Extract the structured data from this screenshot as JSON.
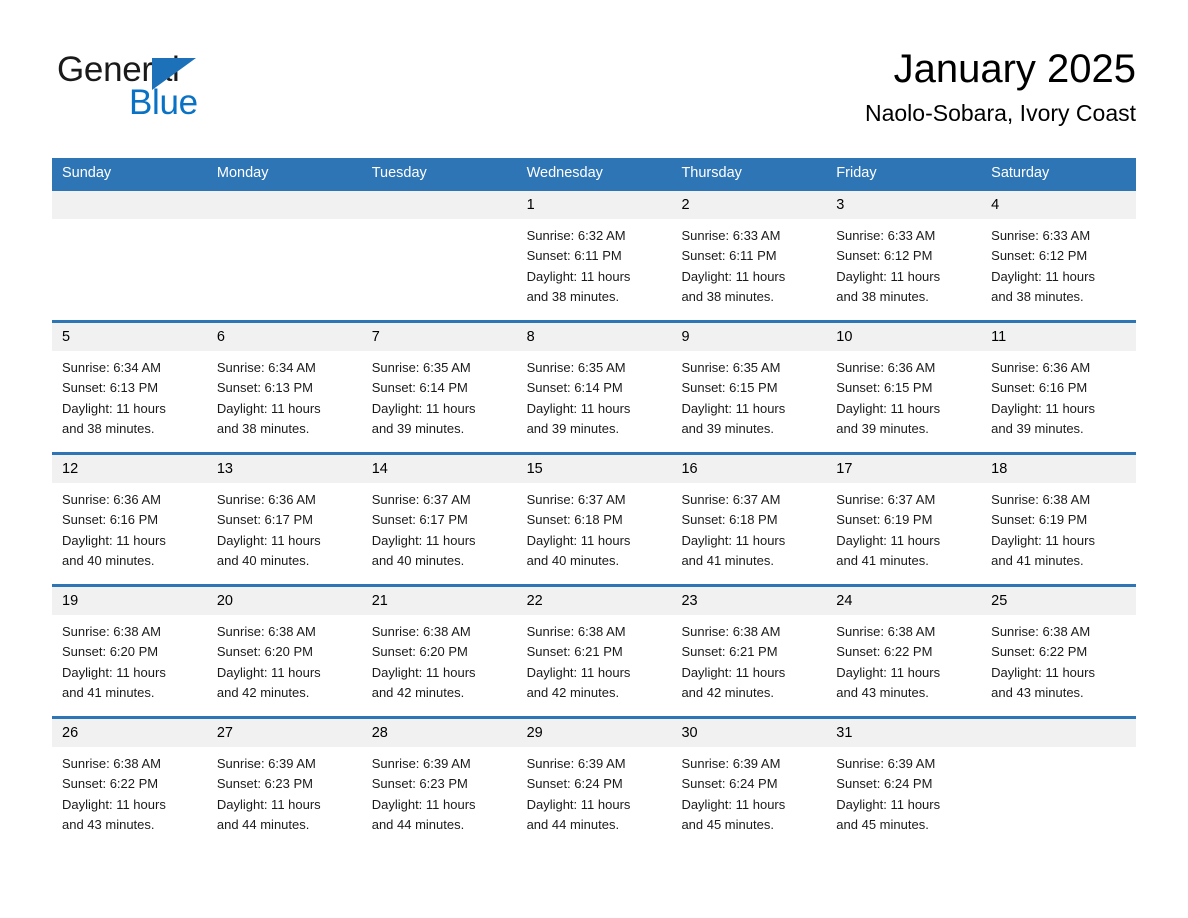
{
  "brand": {
    "word1": "General",
    "word2": "Blue",
    "accent_color": "#0a72c4",
    "triangle_color": "#1d71b8"
  },
  "header": {
    "month_title": "January 2025",
    "location": "Naolo-Sobara, Ivory Coast"
  },
  "calendar": {
    "header_color": "#2e75b6",
    "row_border_color": "#2e75b6",
    "day_band_color": "#f1f1f1",
    "weekdays": [
      "Sunday",
      "Monday",
      "Tuesday",
      "Wednesday",
      "Thursday",
      "Friday",
      "Saturday"
    ],
    "weeks": [
      [
        {
          "day": "",
          "sunrise": "",
          "sunset": "",
          "daylight1": "",
          "daylight2": ""
        },
        {
          "day": "",
          "sunrise": "",
          "sunset": "",
          "daylight1": "",
          "daylight2": ""
        },
        {
          "day": "",
          "sunrise": "",
          "sunset": "",
          "daylight1": "",
          "daylight2": ""
        },
        {
          "day": "1",
          "sunrise": "Sunrise: 6:32 AM",
          "sunset": "Sunset: 6:11 PM",
          "daylight1": "Daylight: 11 hours",
          "daylight2": "and 38 minutes."
        },
        {
          "day": "2",
          "sunrise": "Sunrise: 6:33 AM",
          "sunset": "Sunset: 6:11 PM",
          "daylight1": "Daylight: 11 hours",
          "daylight2": "and 38 minutes."
        },
        {
          "day": "3",
          "sunrise": "Sunrise: 6:33 AM",
          "sunset": "Sunset: 6:12 PM",
          "daylight1": "Daylight: 11 hours",
          "daylight2": "and 38 minutes."
        },
        {
          "day": "4",
          "sunrise": "Sunrise: 6:33 AM",
          "sunset": "Sunset: 6:12 PM",
          "daylight1": "Daylight: 11 hours",
          "daylight2": "and 38 minutes."
        }
      ],
      [
        {
          "day": "5",
          "sunrise": "Sunrise: 6:34 AM",
          "sunset": "Sunset: 6:13 PM",
          "daylight1": "Daylight: 11 hours",
          "daylight2": "and 38 minutes."
        },
        {
          "day": "6",
          "sunrise": "Sunrise: 6:34 AM",
          "sunset": "Sunset: 6:13 PM",
          "daylight1": "Daylight: 11 hours",
          "daylight2": "and 38 minutes."
        },
        {
          "day": "7",
          "sunrise": "Sunrise: 6:35 AM",
          "sunset": "Sunset: 6:14 PM",
          "daylight1": "Daylight: 11 hours",
          "daylight2": "and 39 minutes."
        },
        {
          "day": "8",
          "sunrise": "Sunrise: 6:35 AM",
          "sunset": "Sunset: 6:14 PM",
          "daylight1": "Daylight: 11 hours",
          "daylight2": "and 39 minutes."
        },
        {
          "day": "9",
          "sunrise": "Sunrise: 6:35 AM",
          "sunset": "Sunset: 6:15 PM",
          "daylight1": "Daylight: 11 hours",
          "daylight2": "and 39 minutes."
        },
        {
          "day": "10",
          "sunrise": "Sunrise: 6:36 AM",
          "sunset": "Sunset: 6:15 PM",
          "daylight1": "Daylight: 11 hours",
          "daylight2": "and 39 minutes."
        },
        {
          "day": "11",
          "sunrise": "Sunrise: 6:36 AM",
          "sunset": "Sunset: 6:16 PM",
          "daylight1": "Daylight: 11 hours",
          "daylight2": "and 39 minutes."
        }
      ],
      [
        {
          "day": "12",
          "sunrise": "Sunrise: 6:36 AM",
          "sunset": "Sunset: 6:16 PM",
          "daylight1": "Daylight: 11 hours",
          "daylight2": "and 40 minutes."
        },
        {
          "day": "13",
          "sunrise": "Sunrise: 6:36 AM",
          "sunset": "Sunset: 6:17 PM",
          "daylight1": "Daylight: 11 hours",
          "daylight2": "and 40 minutes."
        },
        {
          "day": "14",
          "sunrise": "Sunrise: 6:37 AM",
          "sunset": "Sunset: 6:17 PM",
          "daylight1": "Daylight: 11 hours",
          "daylight2": "and 40 minutes."
        },
        {
          "day": "15",
          "sunrise": "Sunrise: 6:37 AM",
          "sunset": "Sunset: 6:18 PM",
          "daylight1": "Daylight: 11 hours",
          "daylight2": "and 40 minutes."
        },
        {
          "day": "16",
          "sunrise": "Sunrise: 6:37 AM",
          "sunset": "Sunset: 6:18 PM",
          "daylight1": "Daylight: 11 hours",
          "daylight2": "and 41 minutes."
        },
        {
          "day": "17",
          "sunrise": "Sunrise: 6:37 AM",
          "sunset": "Sunset: 6:19 PM",
          "daylight1": "Daylight: 11 hours",
          "daylight2": "and 41 minutes."
        },
        {
          "day": "18",
          "sunrise": "Sunrise: 6:38 AM",
          "sunset": "Sunset: 6:19 PM",
          "daylight1": "Daylight: 11 hours",
          "daylight2": "and 41 minutes."
        }
      ],
      [
        {
          "day": "19",
          "sunrise": "Sunrise: 6:38 AM",
          "sunset": "Sunset: 6:20 PM",
          "daylight1": "Daylight: 11 hours",
          "daylight2": "and 41 minutes."
        },
        {
          "day": "20",
          "sunrise": "Sunrise: 6:38 AM",
          "sunset": "Sunset: 6:20 PM",
          "daylight1": "Daylight: 11 hours",
          "daylight2": "and 42 minutes."
        },
        {
          "day": "21",
          "sunrise": "Sunrise: 6:38 AM",
          "sunset": "Sunset: 6:20 PM",
          "daylight1": "Daylight: 11 hours",
          "daylight2": "and 42 minutes."
        },
        {
          "day": "22",
          "sunrise": "Sunrise: 6:38 AM",
          "sunset": "Sunset: 6:21 PM",
          "daylight1": "Daylight: 11 hours",
          "daylight2": "and 42 minutes."
        },
        {
          "day": "23",
          "sunrise": "Sunrise: 6:38 AM",
          "sunset": "Sunset: 6:21 PM",
          "daylight1": "Daylight: 11 hours",
          "daylight2": "and 42 minutes."
        },
        {
          "day": "24",
          "sunrise": "Sunrise: 6:38 AM",
          "sunset": "Sunset: 6:22 PM",
          "daylight1": "Daylight: 11 hours",
          "daylight2": "and 43 minutes."
        },
        {
          "day": "25",
          "sunrise": "Sunrise: 6:38 AM",
          "sunset": "Sunset: 6:22 PM",
          "daylight1": "Daylight: 11 hours",
          "daylight2": "and 43 minutes."
        }
      ],
      [
        {
          "day": "26",
          "sunrise": "Sunrise: 6:38 AM",
          "sunset": "Sunset: 6:22 PM",
          "daylight1": "Daylight: 11 hours",
          "daylight2": "and 43 minutes."
        },
        {
          "day": "27",
          "sunrise": "Sunrise: 6:39 AM",
          "sunset": "Sunset: 6:23 PM",
          "daylight1": "Daylight: 11 hours",
          "daylight2": "and 44 minutes."
        },
        {
          "day": "28",
          "sunrise": "Sunrise: 6:39 AM",
          "sunset": "Sunset: 6:23 PM",
          "daylight1": "Daylight: 11 hours",
          "daylight2": "and 44 minutes."
        },
        {
          "day": "29",
          "sunrise": "Sunrise: 6:39 AM",
          "sunset": "Sunset: 6:24 PM",
          "daylight1": "Daylight: 11 hours",
          "daylight2": "and 44 minutes."
        },
        {
          "day": "30",
          "sunrise": "Sunrise: 6:39 AM",
          "sunset": "Sunset: 6:24 PM",
          "daylight1": "Daylight: 11 hours",
          "daylight2": "and 45 minutes."
        },
        {
          "day": "31",
          "sunrise": "Sunrise: 6:39 AM",
          "sunset": "Sunset: 6:24 PM",
          "daylight1": "Daylight: 11 hours",
          "daylight2": "and 45 minutes."
        },
        {
          "day": "",
          "sunrise": "",
          "sunset": "",
          "daylight1": "",
          "daylight2": ""
        }
      ]
    ]
  }
}
